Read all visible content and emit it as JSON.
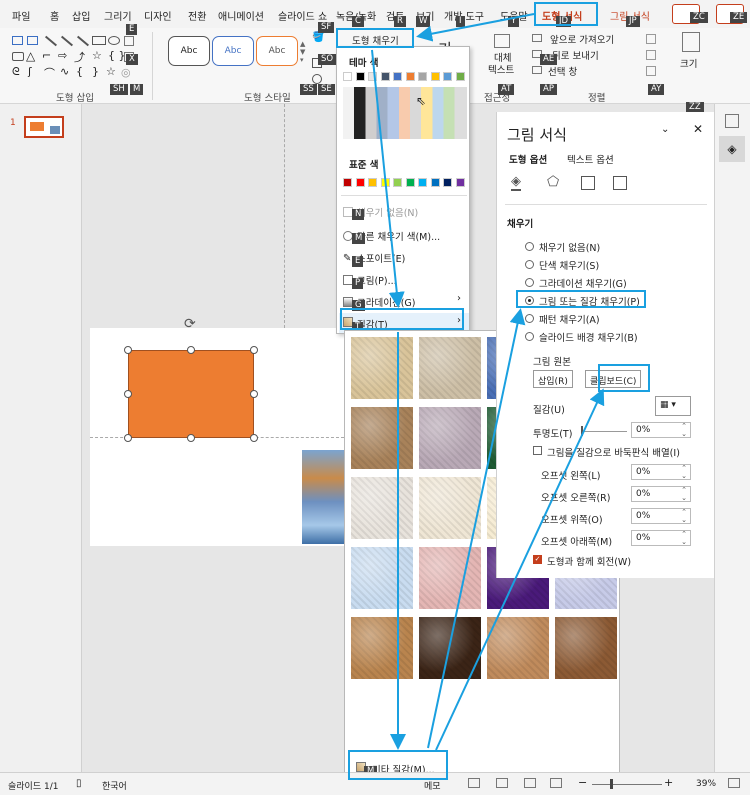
{
  "tabs": [
    "파일",
    "홈",
    "삽입",
    "그리기",
    "디자인",
    "전환",
    "애니메이션",
    "슬라이드 쇼",
    "녹음/녹화",
    "검토",
    "보기",
    "개발 도구",
    "도움말",
    "도형 서식",
    "그림 서식"
  ],
  "keytips": {
    "e": "E",
    "x": "X",
    "sh": "SH",
    "m": "M",
    "sf": "SF",
    "c": "C",
    "r": "R",
    "w": "W",
    "so": "SO",
    "ss": "SS",
    "se": "SE",
    "i": "I",
    "y": "Y",
    "jd": "JD",
    "jp": "JP",
    "zc": "ZC",
    "ze": "ZE",
    "ae": "AE",
    "ap": "AP",
    "at": "AT",
    "ay": "AY",
    "zz": "ZZ",
    "n": "N",
    "m2": "M",
    "e2": "E",
    "p": "P",
    "g": "G",
    "t": "T",
    "m3": "M"
  },
  "ribbon": {
    "group_insert_shape": "도형 삽입",
    "group_shape_style": "도형 스타일",
    "style_abc_1": "Abc",
    "style_abc_2": "Abc",
    "style_abc_3": "Abc",
    "shape_fill": "도형 채우기",
    "alt_text_1": "대체",
    "alt_text_2": "텍스트",
    "accessibility": "접근성",
    "bring_forward": "앞으로 가져오기",
    "send_backward": "뒤로 보내기",
    "selection_pane": "선택 창",
    "group_arrange": "정렬",
    "size": "크기",
    "word_art_glyph": "가"
  },
  "fill_menu": {
    "theme_colors": "테마 색",
    "standard_colors": "표준 색",
    "no_fill": "채우기 없음(N)",
    "more_fill_colors": "다른 채우기 색(M)...",
    "eyedropper": "스포이트(E)",
    "picture": "그림(P)...",
    "gradient": "그라데이션(G)",
    "texture": "질감(T)"
  },
  "theme_color_row": [
    "#ffffff",
    "#000000",
    "#e7e6e6",
    "#44546a",
    "#4472c4",
    "#ed7d31",
    "#a5a5a5",
    "#ffc000",
    "#5b9bd5",
    "#70ad47"
  ],
  "standard_color_row": [
    "#c00000",
    "#ff0000",
    "#ffc000",
    "#ffff00",
    "#92d050",
    "#00b050",
    "#00b0f0",
    "#0070c0",
    "#002060",
    "#7030a0"
  ],
  "texture_panel": {
    "more_textures": "기타 질감(M)...",
    "tiles": [
      "#d9c49a",
      "#cdbfa6",
      "#4a6fb5",
      "#9fdbe6",
      "#a8825a",
      "#b9a9b6",
      "#1e5b33",
      "#d6d6d6",
      "#e8e3dc",
      "#efe6d5",
      "#f6ecd3",
      "#e0d0b0",
      "#c9dcf0",
      "#e4b6b4",
      "#4a1a7a",
      "#c7cbe8",
      "#b9844e",
      "#3b2416",
      "#c08b5c",
      "#8c5a34"
    ]
  },
  "pane": {
    "title": "그림 서식",
    "tab_shape_options": "도형 옵션",
    "tab_text_options": "텍스트 옵션",
    "section_fill": "채우기",
    "opt_no_fill": "채우기 없음(N)",
    "opt_solid": "단색 채우기(S)",
    "opt_gradient": "그라데이션 채우기(G)",
    "opt_picture_texture": "그림 또는 질감 채우기(P)",
    "opt_pattern": "패턴 채우기(A)",
    "opt_slide_bg": "슬라이드 배경 채우기(B)",
    "picture_source": "그림 원본",
    "btn_insert": "삽입(R)",
    "btn_clipboard": "클립보드(C)",
    "texture_label": "질감(U)",
    "transparency_label": "투명도(T)",
    "transparency_value": "0%",
    "tile_checkbox": "그림을 질감으로 바둑판식 배열(I)",
    "offset_left": "오프셋 왼쪽(L)",
    "offset_left_val": "0%",
    "offset_right": "오프셋 오른쪽(R)",
    "offset_right_val": "0%",
    "offset_top": "오프셋 위쪽(O)",
    "offset_top_val": "0%",
    "offset_bottom": "오프셋 아래쪽(M)",
    "offset_bottom_val": "0%",
    "rotate_with_shape": "도형과 함께 회전(W)"
  },
  "slide_panel": {
    "slide_number": "1"
  },
  "status": {
    "slide_count": "슬라이드 1/1",
    "language": "한국어",
    "notes": "메모",
    "zoom": "39%"
  },
  "colors": {
    "accent": "#c43e1c",
    "highlight": "#1aa0e0",
    "orange": "#ed7d31"
  }
}
